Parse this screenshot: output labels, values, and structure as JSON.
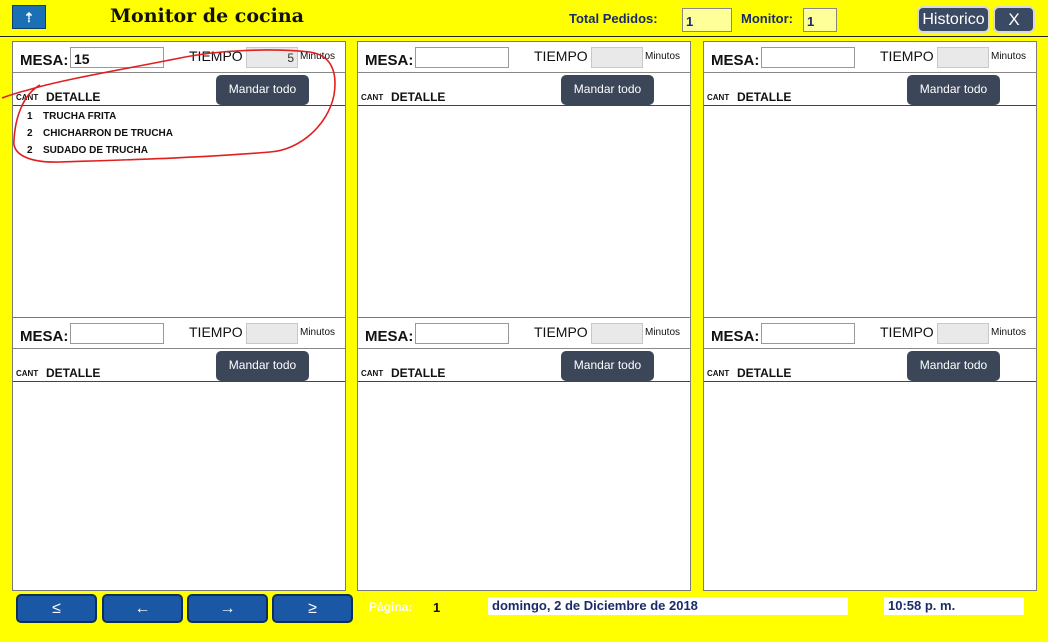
{
  "header": {
    "title": "Monitor de cocina",
    "total_pedidos_label": "Total Pedidos:",
    "total_pedidos_value": "1",
    "monitor_label": "Monitor:",
    "monitor_value": "1",
    "historico_label": "Historico",
    "close_label": "X"
  },
  "panel_common": {
    "mesa_label": "MESA:",
    "tiempo_label": "TIEMPO",
    "minutos_label": "Minutos",
    "button_label": "Mandar todo",
    "cant_label": "CANT",
    "detalle_label": "DETALLE"
  },
  "panels": [
    {
      "mesa": "15",
      "tiempo": "5",
      "items": [
        {
          "qty": "1",
          "desc": "TRUCHA FRITA"
        },
        {
          "qty": "2",
          "desc": "CHICHARRON DE TRUCHA"
        },
        {
          "qty": "2",
          "desc": "SUDADO DE TRUCHA"
        }
      ]
    },
    {
      "mesa": "",
      "tiempo": "",
      "items": []
    },
    {
      "mesa": "",
      "tiempo": "",
      "items": []
    },
    {
      "mesa": "",
      "tiempo": "",
      "items": []
    },
    {
      "mesa": "",
      "tiempo": "",
      "items": []
    },
    {
      "mesa": "",
      "tiempo": "",
      "items": []
    }
  ],
  "footer": {
    "nav_first": "≤",
    "nav_prev": "←",
    "nav_next": "→",
    "nav_last": "≥",
    "pagina_label": "Página:",
    "pagina_value": "1",
    "date": "domingo, 2 de Diciembre de 2018",
    "time": "10:58 p. m."
  },
  "colors": {
    "background": "#ffff00",
    "button": "#3b4659",
    "nav": "#1a58a6",
    "annotation": "#e02020"
  }
}
